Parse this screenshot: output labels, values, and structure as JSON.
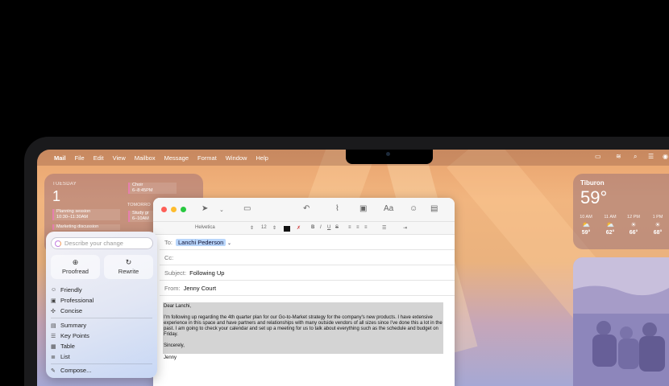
{
  "menubar": {
    "items": [
      "Mail",
      "File",
      "Edit",
      "View",
      "Mailbox",
      "Message",
      "Format",
      "Window",
      "Help"
    ]
  },
  "calendar": {
    "day": "TUESDAY",
    "date": "1",
    "events": [
      {
        "title": "Planning session",
        "time": "10:30–11:30AM"
      },
      {
        "title": "Marketing discussion",
        "time": ""
      },
      {
        "title": "Choir",
        "time": "6–8:45PM"
      }
    ],
    "tomorrow_label": "TOMORRO",
    "tomorrow_event": {
      "title": "Study gr",
      "time": "6–10AM"
    }
  },
  "writing_tools": {
    "placeholder": "Describe your change",
    "proofread": "Proofread",
    "rewrite": "Rewrite",
    "tones": [
      "Friendly",
      "Professional",
      "Concise"
    ],
    "formats": [
      "Summary",
      "Key Points",
      "Table",
      "List"
    ],
    "compose": "Compose..."
  },
  "mail": {
    "format": {
      "font": "Helvetica",
      "size": "12"
    },
    "to_label": "To:",
    "to_value": "Lanchi Pederson",
    "cc_label": "Cc:",
    "subject_label": "Subject:",
    "subject_value": "Following Up",
    "from_label": "From:",
    "from_value": "Jenny Court",
    "body_greeting": "Dear Lanchi,",
    "body_text": "I'm following up regarding the 4th quarter plan for our Go-to-Market strategy for the company's new products. I have extensive experience in this space and have partners and relationships with many outside vendors of all sizes since I've done this a lot in the past. I am going to check your calendar and set up a meeting for us to talk about everything such as the schedule and budget on Friday.",
    "closing": "Sincerely,",
    "signature": "Jenny"
  },
  "weather": {
    "city": "Tiburon",
    "temp": "59°",
    "hours": [
      {
        "time": "10 AM",
        "temp": "59°",
        "icon": "partly-cloudy-icon"
      },
      {
        "time": "11 AM",
        "temp": "62°",
        "icon": "partly-cloudy-icon"
      },
      {
        "time": "12 PM",
        "temp": "66°",
        "icon": "sun-icon"
      },
      {
        "time": "1 PM",
        "temp": "68°",
        "icon": "sun-icon"
      }
    ]
  }
}
